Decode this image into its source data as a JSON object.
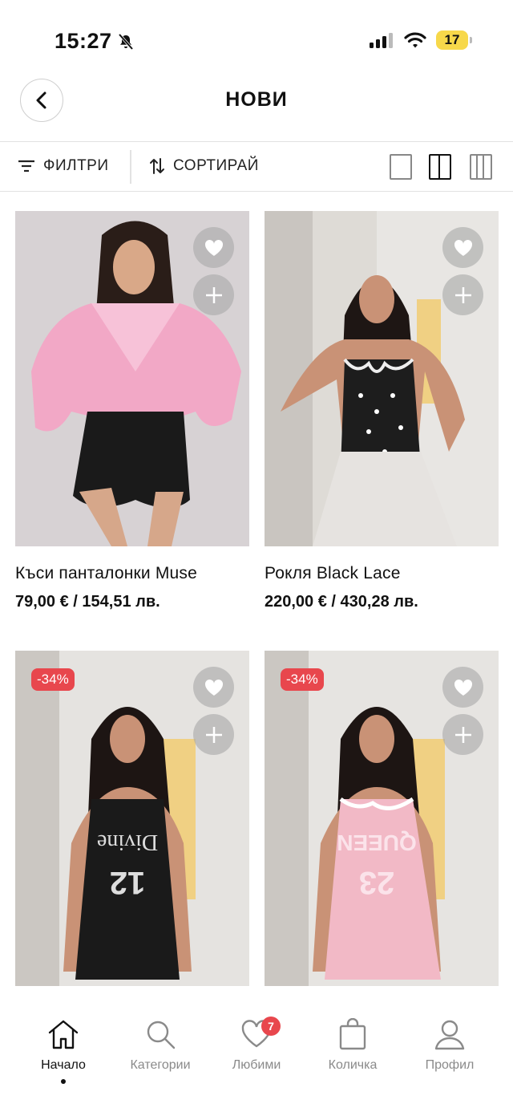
{
  "status": {
    "time": "15:27",
    "battery": "17"
  },
  "header": {
    "title": "НОВИ"
  },
  "toolbar": {
    "filter_label": "ФИЛТРИ",
    "sort_label": "СОРТИРАЙ"
  },
  "products": [
    {
      "name": "Къси панталонки Muse",
      "price": "79,00 € / 154,51 лв.",
      "discount": ""
    },
    {
      "name": "Рокля Black Lace",
      "price": "220,00 € / 430,28 лв.",
      "discount": ""
    },
    {
      "name": "",
      "price": "",
      "discount": "-34%"
    },
    {
      "name": "",
      "price": "",
      "discount": "-34%"
    }
  ],
  "nav": {
    "items": [
      {
        "label": "Начало",
        "icon": "home-icon"
      },
      {
        "label": "Категории",
        "icon": "search-icon"
      },
      {
        "label": "Любими",
        "icon": "heart-icon",
        "badge": "7"
      },
      {
        "label": "Количка",
        "icon": "bag-icon"
      },
      {
        "label": "Профил",
        "icon": "user-icon"
      }
    ]
  },
  "colors": {
    "accent": "#e8474d",
    "battery": "#f7d84a"
  }
}
